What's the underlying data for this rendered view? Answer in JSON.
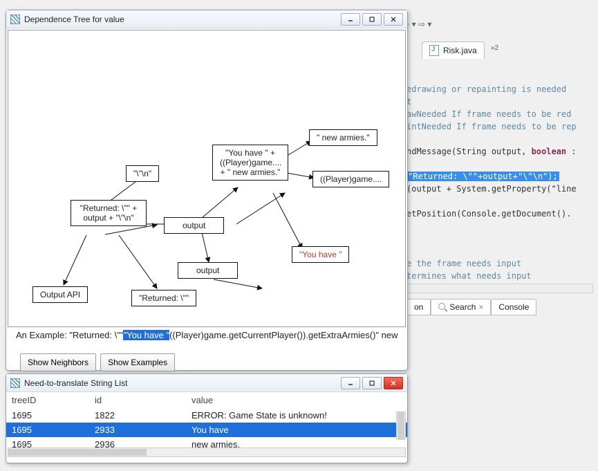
{
  "background": {
    "tab_file": "Risk.java",
    "overflow_count": "»2",
    "code": {
      "c1": "edrawing or repainting is needed",
      "c2": "t",
      "c3": "awNeeded If frame needs to be red",
      "c4": "intNeeded If frame needs to be rep",
      "l5a": "ndMessage(String output, ",
      "l5b": "boolean ",
      "hl": "\"Returned: \\\"\"+output+\"\\\"\\n\");",
      "l7": "(output + System.getProperty(\"line",
      "l8": "etPosition(Console.getDocument().",
      "c9": "e the frame needs input",
      "c10": "termines what needs input"
    },
    "bottom_tabs": {
      "on_cut": "on",
      "search": "Search",
      "console": "Console"
    }
  },
  "depWindow": {
    "title": "Dependence Tree for value",
    "nodes": {
      "n_backslash": "\"\\\"\\n\"",
      "n_returned_full": "\"Returned: \\\"\" + output + \"\\\"\\n\"",
      "n_output1": "output",
      "n_output2": "output",
      "n_output_api": "Output API",
      "n_returned_short": "\"Returned: \\\"\"",
      "n_you_have_block": "\"You have \" + ((Player)game.... + \" new armies.\"",
      "n_new_armies": "\" new armies.\"",
      "n_player": "((Player)game....",
      "n_you_have_red": "\"You have \""
    },
    "example_prefix": "An Example: \"Returned: \\\"\"",
    "example_highlight": "\"You have \"",
    "example_suffix": "((Player)game.getCurrentPlayer()).getExtraArmies()\" new arm",
    "btn_neighbors": "Show Neighbors",
    "btn_examples": "Show Examples"
  },
  "listWindow": {
    "title": "Need-to-translate String List",
    "headers": {
      "treeID": "treeID",
      "id": "id",
      "value": "value"
    },
    "rows": [
      {
        "treeID": "1695",
        "id": "1822",
        "value": "ERROR: Game State is unknown!",
        "selected": false
      },
      {
        "treeID": "1695",
        "id": "2933",
        "value": "You have",
        "selected": true
      },
      {
        "treeID": "1695",
        "id": "2936",
        "value": "new armies.",
        "selected": false
      }
    ]
  }
}
